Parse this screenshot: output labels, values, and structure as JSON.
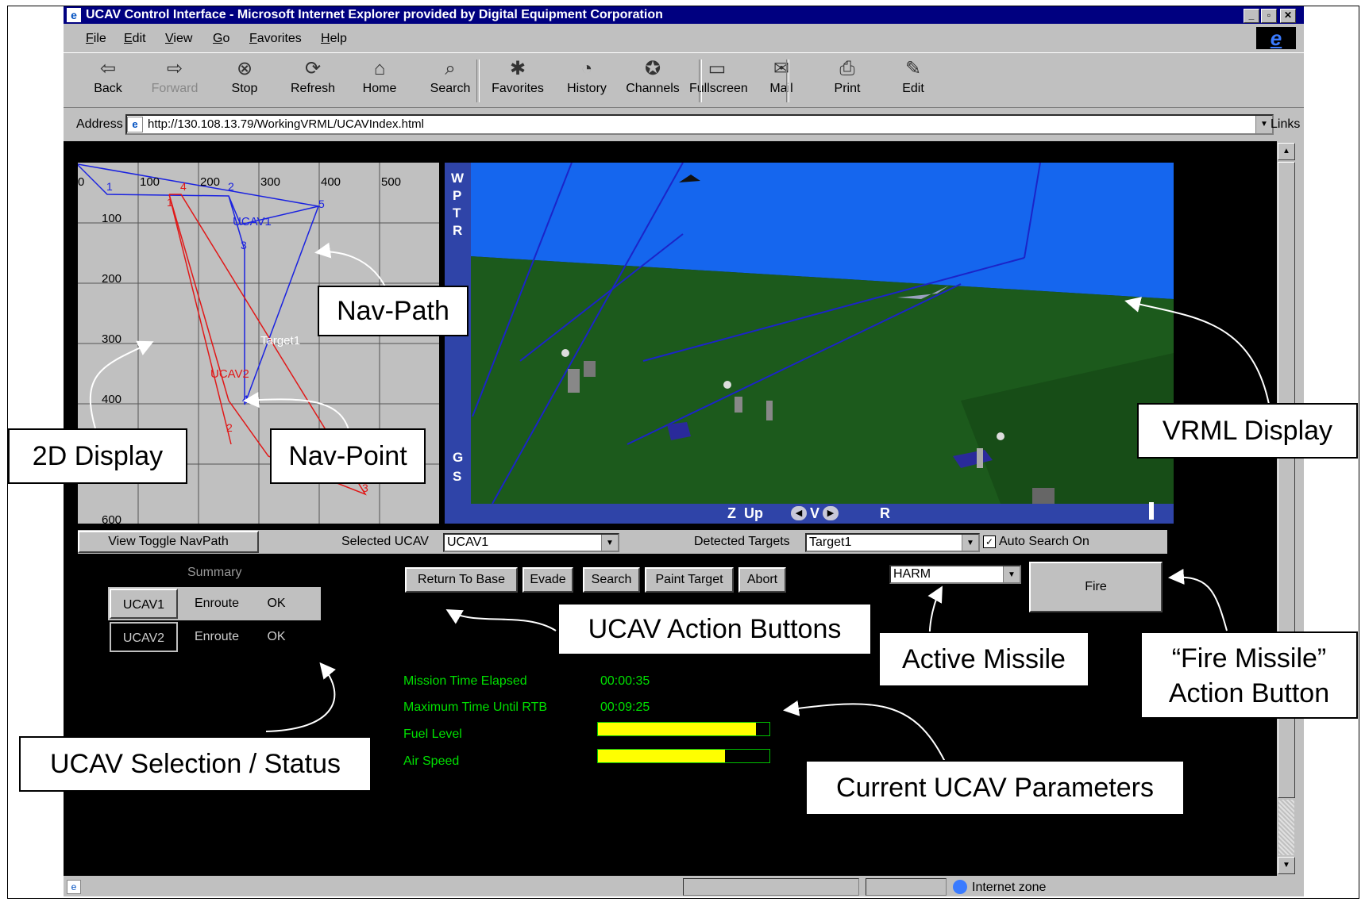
{
  "window": {
    "title": "UCAV Control Interface - Microsoft Internet Explorer provided by Digital Equipment Corporation"
  },
  "menu": [
    "File",
    "Edit",
    "View",
    "Go",
    "Favorites",
    "Help"
  ],
  "toolbar": [
    {
      "label": "Back",
      "icon": "back-arrow-icon"
    },
    {
      "label": "Forward",
      "icon": "forward-arrow-icon",
      "disabled": true
    },
    {
      "label": "Stop",
      "icon": "stop-icon"
    },
    {
      "label": "Refresh",
      "icon": "refresh-icon"
    },
    {
      "label": "Home",
      "icon": "home-icon"
    },
    {
      "label": "Search",
      "icon": "search-icon"
    },
    {
      "label": "Favorites",
      "icon": "favorites-icon"
    },
    {
      "label": "History",
      "icon": "history-icon"
    },
    {
      "label": "Channels",
      "icon": "channels-icon"
    },
    {
      "label": "Fullscreen",
      "icon": "fullscreen-icon"
    },
    {
      "label": "Mail",
      "icon": "mail-icon"
    },
    {
      "label": "Print",
      "icon": "print-icon"
    },
    {
      "label": "Edit",
      "icon": "edit-icon"
    }
  ],
  "address": {
    "label": "Address",
    "url": "http://130.108.13.79/WorkingVRML/UCAVIndex.html",
    "links": "Links"
  },
  "map2d": {
    "x_ticks": [
      "0",
      "100",
      "200",
      "300",
      "400",
      "500"
    ],
    "y_ticks": [
      "100",
      "200",
      "300",
      "400",
      "600"
    ],
    "blue_label": "UCAV1",
    "red_label": "UCAV2",
    "target_label": "Target1",
    "blue_points": [
      "1",
      "2",
      "3",
      "4",
      "5"
    ],
    "red_points": [
      "1",
      "2",
      "3",
      "4"
    ]
  },
  "vrml": {
    "left_letters": [
      "W",
      "P",
      "T",
      "R",
      "G",
      "S"
    ],
    "bottom_controls": "Z  Up",
    "v_label": "V",
    "r_label": "R"
  },
  "controls": {
    "view_toggle": "View Toggle NavPath",
    "selected_ucav_label": "Selected UCAV",
    "selected_ucav": "UCAV1",
    "detected_targets_label": "Detected Targets",
    "detected_target": "Target1",
    "auto_search": "Auto Search On"
  },
  "summary": {
    "title": "Summary",
    "rows": [
      {
        "name": "UCAV1",
        "state": "Enroute",
        "status": "OK"
      },
      {
        "name": "UCAV2",
        "state": "Enroute",
        "status": "OK"
      }
    ]
  },
  "actions": [
    "Return To Base",
    "Evade",
    "Search",
    "Paint Target",
    "Abort"
  ],
  "missile": {
    "selected": "HARM",
    "fire": "Fire"
  },
  "params": {
    "mission_time_label": "Mission Time Elapsed",
    "mission_time": "00:00:35",
    "max_time_label": "Maximum Time Until RTB",
    "max_time": "00:09:25",
    "fuel_label": "Fuel Level",
    "fuel_level": 0.92,
    "airspeed_label": "Air Speed",
    "airspeed_level": 0.74
  },
  "status": {
    "zone": "Internet zone"
  },
  "callouts": {
    "nav_path": "Nav-Path",
    "nav_point": "Nav-Point",
    "display2d": "2D Display",
    "vrml": "VRML Display",
    "action_buttons": "UCAV Action Buttons",
    "active_missile": "Active Missile",
    "fire_line1": "“Fire Missile”",
    "fire_line2": "Action Button",
    "selection": "UCAV Selection / Status",
    "params": "Current UCAV Parameters"
  }
}
